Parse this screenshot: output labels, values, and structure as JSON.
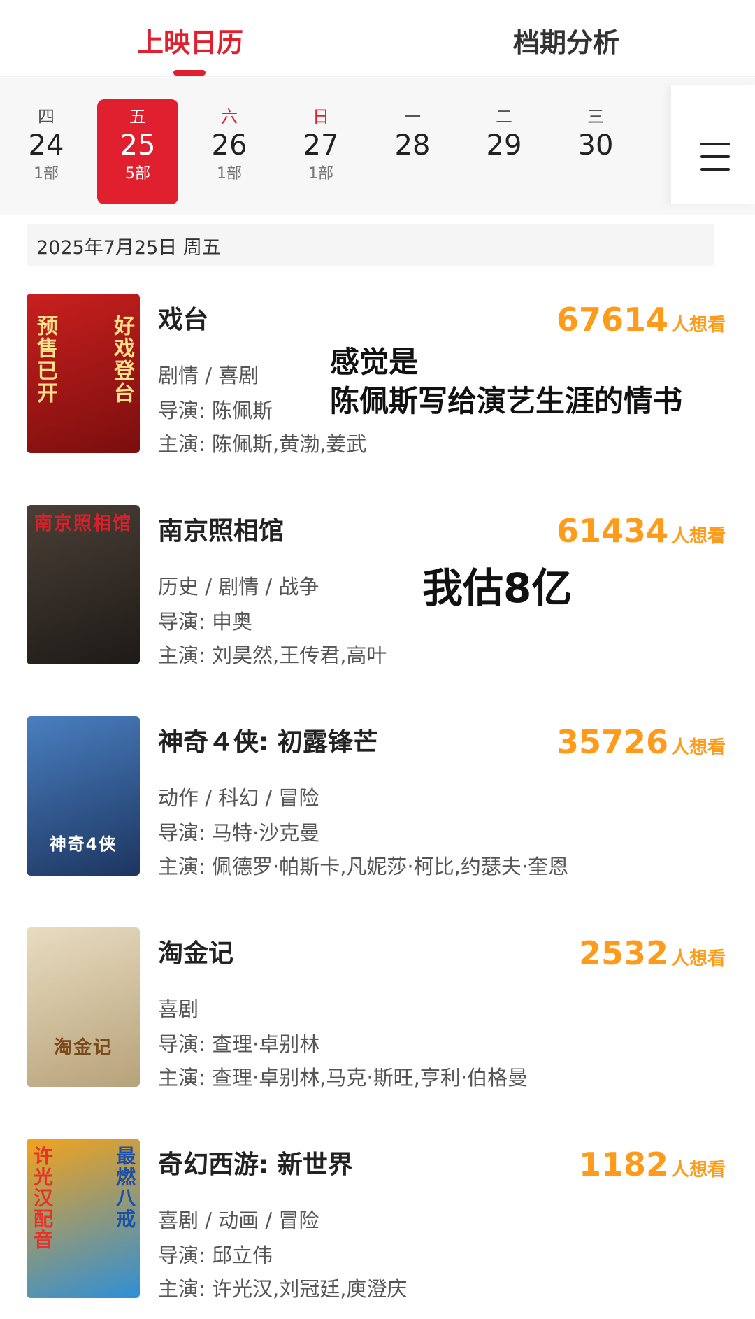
{
  "tabs": {
    "calendar": "上映日历",
    "analysis": "档期分析"
  },
  "dates": [
    {
      "weekday": "四",
      "day": "24",
      "count": "1部",
      "weekend": false,
      "selected": false
    },
    {
      "weekday": "五",
      "day": "25",
      "count": "5部",
      "weekend": false,
      "selected": true
    },
    {
      "weekday": "六",
      "day": "26",
      "count": "1部",
      "weekend": true,
      "selected": false
    },
    {
      "weekday": "日",
      "day": "27",
      "count": "1部",
      "weekend": true,
      "selected": false
    },
    {
      "weekday": "一",
      "day": "28",
      "count": "",
      "weekend": false,
      "selected": false
    },
    {
      "weekday": "二",
      "day": "29",
      "count": "",
      "weekend": false,
      "selected": false
    },
    {
      "weekday": "三",
      "day": "30",
      "count": "",
      "weekend": false,
      "selected": false
    }
  ],
  "date_header": "2025年7月25日  周五",
  "want_unit": "人想看",
  "movies": [
    {
      "title": "戏台",
      "want": "67614",
      "genre": "剧情 / 喜剧",
      "director": "导演:  陈佩斯",
      "cast": "主演:  陈佩斯,黄渤,姜武",
      "poster_caption_left": "预售已开",
      "poster_caption_right": "好戏登台",
      "poster_colors": [
        "#c8201e",
        "#7a0e0e"
      ]
    },
    {
      "title": "南京照相馆",
      "want": "61434",
      "genre": "历史 / 剧情 / 战争",
      "director": "导演:  申奥",
      "cast": "主演:  刘昊然,王传君,高叶",
      "poster_caption_left": "",
      "poster_caption_right": "南京照相馆",
      "poster_colors": [
        "#4a3f36",
        "#1e1a17"
      ]
    },
    {
      "title": "神奇４侠:  初露锋芒",
      "want": "35726",
      "genre": "动作 / 科幻 / 冒险",
      "director": "导演:  马特·沙克曼",
      "cast": "主演:  佩德罗·帕斯卡,凡妮莎·柯比,约瑟夫·奎恩",
      "poster_caption_left": "",
      "poster_caption_right": "神奇4侠",
      "poster_colors": [
        "#4a7fc0",
        "#1c3560"
      ]
    },
    {
      "title": "淘金记",
      "want": "2532",
      "genre": "喜剧",
      "director": "导演:  查理·卓别林",
      "cast": "主演:  查理·卓别林,马克·斯旺,亨利·伯格曼",
      "poster_caption_left": "",
      "poster_caption_right": "淘金记",
      "poster_colors": [
        "#e8dcc0",
        "#b7a27a"
      ]
    },
    {
      "title": "奇幻西游:  新世界",
      "want": "1182",
      "genre": "喜剧 / 动画 / 冒险",
      "director": "导演:  邱立伟",
      "cast": "主演:  许光汉,刘冠廷,庾澄庆",
      "poster_caption_left": "许光汉配音",
      "poster_caption_right": "最燃八戒",
      "poster_colors": [
        "#f3a31c",
        "#2e8fd6"
      ]
    }
  ],
  "overlays": {
    "caption1_line1": "感觉是",
    "caption1_line2": "陈佩斯写给演艺生涯的情书",
    "caption2": "我估8亿"
  }
}
